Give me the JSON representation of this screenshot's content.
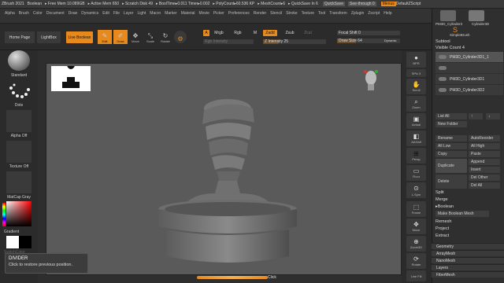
{
  "titlebar": {
    "app": "ZBrush 2021",
    "doc": "Boolean",
    "stats": [
      "▸ Free Mem 10.089GB",
      "▸ Active Mem 650",
      "▸ Scratch Disk 49",
      "▸ BoolTime▸0.011 Timer▸0.002",
      "▸ PolyCount▸60.536 KP",
      "▸ MeshCount▸6",
      "▸ QuickSave In 6"
    ],
    "quicksave": "QuickSave",
    "seethrough": "See-through  0",
    "menus": "Menus",
    "script": "DefaultZScript"
  },
  "menubar": [
    "Alpha",
    "Brush",
    "Color",
    "Document",
    "Draw",
    "Dynamics",
    "Edit",
    "File",
    "Layer",
    "Light",
    "Macro",
    "Marker",
    "Material",
    "Movie",
    "Picker",
    "Preferences",
    "Render",
    "Stencil",
    "Stroke",
    "Texture",
    "Tool",
    "Transform",
    "Zplugin",
    "Zscript",
    "Help"
  ],
  "toolbar": {
    "home": "Home Page",
    "lightbox": "LightBox",
    "live_boolean": "Live Boolean",
    "edit": "Edit",
    "draw": "Draw",
    "move": "Move",
    "scale": "Scale",
    "rotate": "Rotate",
    "a": "A",
    "mrgb": "Mrgb",
    "rgb": "Rgb",
    "m": "M",
    "zadd": "Zadd",
    "zsub": "Zsub",
    "zcut": "Zcut",
    "rgb_intensity": "Rgb Intensity",
    "z_intensity": "Z Intensity 25",
    "focal_shift": "Focal Shift 0",
    "draw_size": "Draw Size 64",
    "dynamic": "Dynamic"
  },
  "left_shelf": {
    "standard": "Standard",
    "dots": "Dots",
    "alpha_off": "Alpha Off",
    "texture_off": "Texture Off",
    "matcap": "MatCap Gray",
    "gradient": "Gradient",
    "switch_color": "SwitchColor"
  },
  "right_shelf": [
    "BPR",
    "SPix 3",
    "Scroll",
    "Zoom",
    "Actual",
    "AAHalf",
    "Persp",
    "Floor",
    "Local",
    "L.Sym",
    "Frame",
    "Move",
    "Zoom3D",
    "Rotate",
    "Line Fill",
    "PolyF",
    "Transp",
    "Dynamic",
    "Solo",
    "Xpose"
  ],
  "right_panel": {
    "tools": [
      "PM3D_Cylinder3",
      "Cylinder3D",
      "SimpleBrush"
    ],
    "subtool": "Subtool",
    "visible_count": "Visible Count 4",
    "subtools": [
      "PM3D_Cylinder3D1_1",
      "PM3D_Cylinder3D1",
      "PM3D_Cylinder3D2"
    ],
    "list_all": "List All",
    "new_folder": "New Folder",
    "rename": "Rename",
    "autoreorder": "AutoReorder",
    "all_low": "All Low",
    "all_high": "All High",
    "copy": "Copy",
    "paste": "Paste",
    "duplicate": "Duplicate",
    "append": "Append",
    "insert": "Insert",
    "delete": "Delete",
    "del_other": "Del Other",
    "del_all": "Del All",
    "split": "Split",
    "merge": "Merge",
    "boolean": "Boolean",
    "make_boolean_mesh": "Make Boolean Mesh",
    "remesh": "Remesh",
    "project": "Project",
    "extract": "Extract",
    "sections": [
      "Geometry",
      "ArrayMesh",
      "NanoMesh",
      "Layers",
      "FiberMesh"
    ]
  },
  "tooltip": {
    "title": "DIVIDER",
    "body": "Click to restore previous position."
  },
  "bottom_text": "Click",
  "colors": {
    "accent": "#e8891e",
    "bg": "#2e2e2e",
    "viewport": "#5a5a5a"
  }
}
